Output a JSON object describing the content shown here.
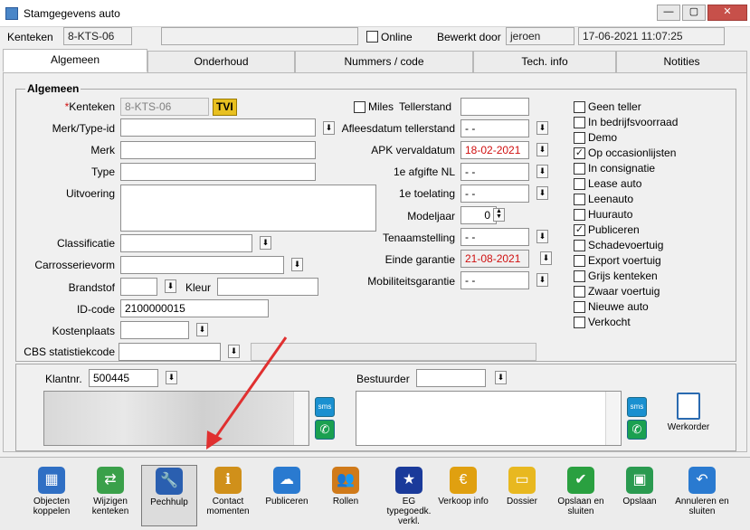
{
  "window": {
    "title": "Stamgegevens auto",
    "minimize": "—",
    "maximize": "▢",
    "close": "✕"
  },
  "header": {
    "kenteken_label": "Kenteken",
    "kenteken_value": "8-KTS-06",
    "online_label": "Online",
    "bewerkt_door_label": "Bewerkt door",
    "bewerkt_door_value": "jeroen",
    "timestamp": "17-06-2021 11:07:25"
  },
  "tabs": [
    {
      "label": "Algemeen",
      "active": true
    },
    {
      "label": "Onderhoud",
      "active": false
    },
    {
      "label": "Nummers / code",
      "active": false
    },
    {
      "label": "Tech. info",
      "active": false
    },
    {
      "label": "Notities",
      "active": false
    }
  ],
  "algemeen": {
    "group_title": "Algemeen",
    "kenteken_label": "Kenteken",
    "kenteken_required_mark": "*",
    "kenteken_value": "8-KTS-06",
    "tvi_label": "TVI",
    "merk_type_id_label": "Merk/Type-id",
    "merk_label": "Merk",
    "type_label": "Type",
    "uitvoering_label": "Uitvoering",
    "classificatie_label": "Classificatie",
    "carrosserievorm_label": "Carrosserievorm",
    "brandstof_label": "Brandstof",
    "kleur_label": "Kleur",
    "id_code_label": "ID-code",
    "id_code_value": "2100000015",
    "kostenplaats_label": "Kostenplaats",
    "cbs_label": "CBS statistiekcode"
  },
  "middle": {
    "miles_label": "Miles",
    "tellerstand_label": "Tellerstand",
    "afleesdatum_label": "Afleesdatum tellerstand",
    "afleesdatum_value": "- -",
    "apk_label": "APK vervaldatum",
    "apk_value": "18-02-2021",
    "afgifte_label": "1e afgifte NL",
    "afgifte_value": "- -",
    "toelating_label": "1e toelating",
    "toelating_value": "- -",
    "modeljaar_label": "Modeljaar",
    "modeljaar_value": "0",
    "tenaamstelling_label": "Tenaamstelling",
    "tenaamstelling_value": "- -",
    "einde_garantie_label": "Einde garantie",
    "einde_garantie_value": "21-08-2021",
    "mobiliteit_label": "Mobiliteitsgarantie",
    "mobiliteit_value": "- -"
  },
  "flags": [
    {
      "label": "Geen teller",
      "checked": false
    },
    {
      "label": "In bedrijfsvoorraad",
      "checked": false
    },
    {
      "label": "Demo",
      "checked": false
    },
    {
      "label": "Op occasionlijsten",
      "checked": true
    },
    {
      "label": "In consignatie",
      "checked": false
    },
    {
      "label": "Lease auto",
      "checked": false
    },
    {
      "label": "Leenauto",
      "checked": false
    },
    {
      "label": "Huurauto",
      "checked": false
    },
    {
      "label": "Publiceren",
      "checked": true
    },
    {
      "label": "Schadevoertuig",
      "checked": false
    },
    {
      "label": "Export voertuig",
      "checked": false
    },
    {
      "label": "Grijs kenteken",
      "checked": false
    },
    {
      "label": "Zwaar voertuig",
      "checked": false
    },
    {
      "label": "Nieuwe auto",
      "checked": false
    },
    {
      "label": "Verkocht",
      "checked": false
    }
  ],
  "klant": {
    "klantnr_label": "Klantnr.",
    "klantnr_value": "500445",
    "bestuurder_label": "Bestuurder",
    "sms_label": "sms",
    "whatsapp_icon": "✆",
    "werkorder_label": "Werkorder"
  },
  "toolbar": [
    {
      "label": "Objecten koppelen",
      "icon": "objects-icon",
      "color": "#2f6fc4"
    },
    {
      "label": "Wijzigen kenteken",
      "icon": "change-plate-icon",
      "color": "#3aa04a"
    },
    {
      "label": "Pechhulp",
      "icon": "wrench-icon",
      "color": "#2a5fb0",
      "selected": true
    },
    {
      "label": "Contact momenten",
      "icon": "contact-icon",
      "color": "#d0901a"
    },
    {
      "label": "Publiceren",
      "icon": "cloud-icon",
      "color": "#2a7ad0"
    },
    {
      "label": "Rollen",
      "icon": "roles-icon",
      "color": "#d07a1a"
    },
    {
      "label": "EG typegoedk. verkl.",
      "icon": "eu-flag-icon",
      "color": "#1a3a9a"
    },
    {
      "label": "Verkoop info",
      "icon": "euro-icon",
      "color": "#e0a010"
    },
    {
      "label": "Dossier",
      "icon": "folder-icon",
      "color": "#e8b820"
    },
    {
      "label": "Opslaan en sluiten",
      "icon": "check-icon",
      "color": "#2aa040"
    },
    {
      "label": "Opslaan",
      "icon": "save-icon",
      "color": "#2a9a50"
    },
    {
      "label": "Annuleren en sluiten",
      "icon": "undo-icon",
      "color": "#2a7ad0"
    }
  ]
}
